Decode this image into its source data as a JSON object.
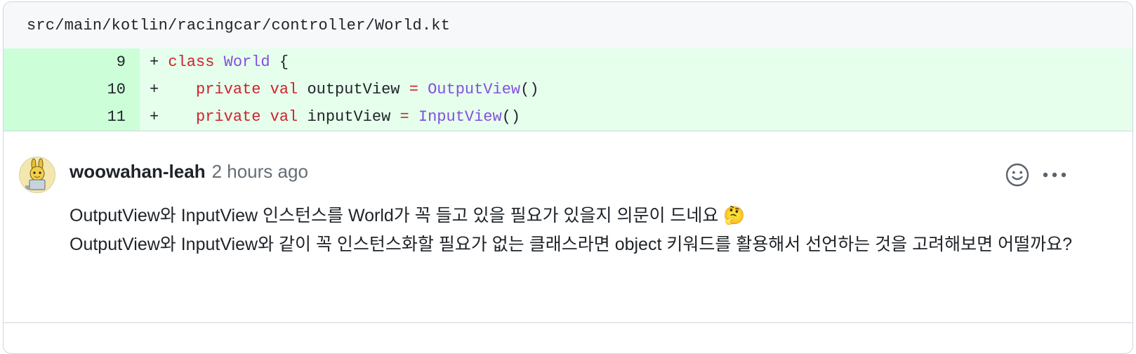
{
  "file": {
    "path": "src/main/kotlin/racingcar/controller/World.kt"
  },
  "diff_lines": [
    {
      "number": "9",
      "marker": "+",
      "kw1": "class",
      "name": "World",
      "rest": " {"
    },
    {
      "number": "10",
      "marker": "+",
      "indent": "    ",
      "kw1": "private",
      "kw2": "val",
      "ident": "outputView",
      "eq": "=",
      "type": "OutputView",
      "call": "()"
    },
    {
      "number": "11",
      "marker": "+",
      "indent": "    ",
      "kw1": "private",
      "kw2": "val",
      "ident": "inputView",
      "eq": "=",
      "type": "InputView",
      "call": "()"
    }
  ],
  "comment": {
    "author": "woowahan-leah",
    "time": "2 hours ago",
    "line1": "OutputView와 InputView 인스턴스를 World가 꼭 들고 있을 필요가 있을지 의문이 드네요 🤔",
    "line2": "OutputView와 InputView와 같이 꼭 인스턴스화할 필요가 없는 클래스라면 object 키워드를 활용해서 선언하는 것을 고려해보면 어떨까요?",
    "icons": {
      "reaction": "smiley-icon",
      "more": "kebab-horizontal-icon",
      "avatar": "avatar"
    }
  },
  "colors": {
    "added_line_bg": "#e6ffec",
    "added_number_bg": "#ccffd8",
    "keyword": "#cf222e",
    "type": "#8250df"
  }
}
